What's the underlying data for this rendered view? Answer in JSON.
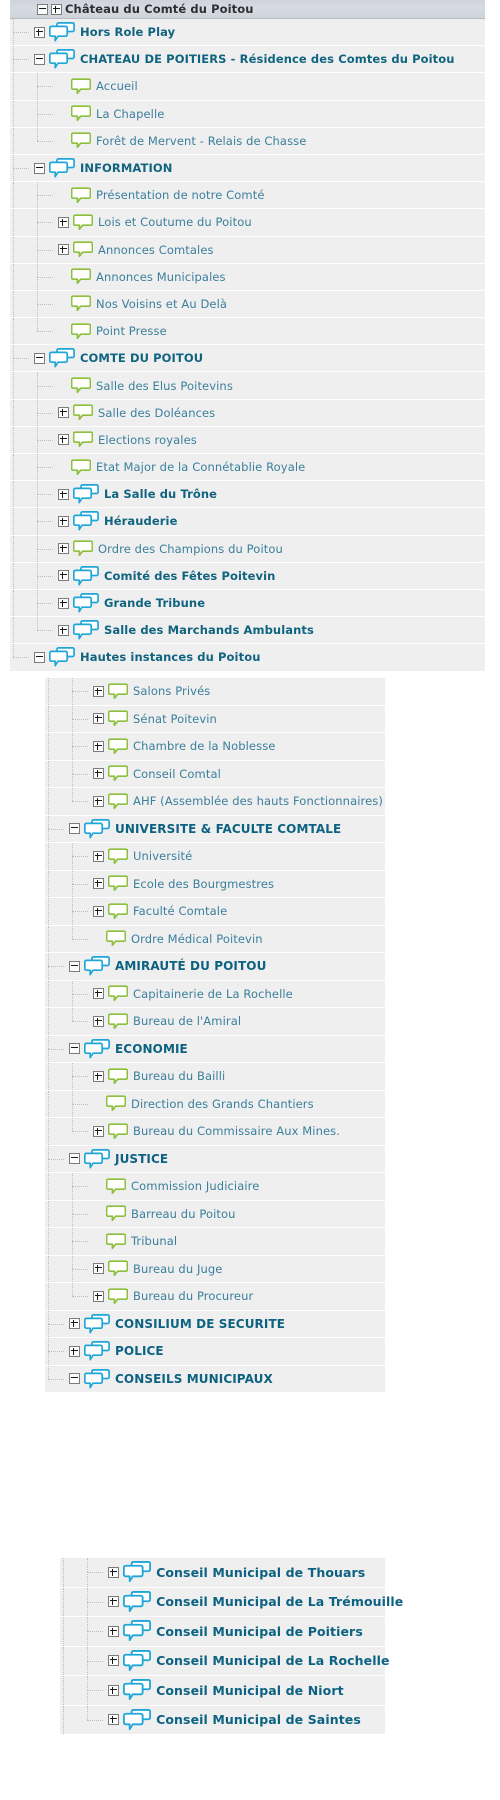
{
  "colors": {
    "row_bg": "#efeff0",
    "header_bg": "#d3d7de",
    "category_text": "#10647f",
    "subforum_text": "#3a7f9b",
    "root_text": "#2f2f33",
    "bubble_blue": "#1fa6d8",
    "bubble_green": "#8dbf3c"
  },
  "root": {
    "label": "Château du Comté du Poitou",
    "toggle_minus": "-",
    "toggle_plus": "+"
  },
  "sections": {
    "top": [
      {
        "label": "Hors Role Play",
        "style": "cat",
        "icon": "double-bubble-blue-icon",
        "toggle": "plus",
        "indent": 1
      },
      {
        "label": "CHATEAU DE POITIERS - Résidence des Comtes du Poitou",
        "style": "cat",
        "icon": "double-bubble-blue-icon",
        "toggle": "minus",
        "indent": 1
      },
      {
        "label": "Accueil",
        "style": "sub",
        "icon": "single-bubble-green-icon",
        "toggle": "none",
        "indent": 2
      },
      {
        "label": "La Chapelle",
        "style": "sub",
        "icon": "single-bubble-green-icon",
        "toggle": "none",
        "indent": 2
      },
      {
        "label": "Forêt de Mervent - Relais de Chasse",
        "style": "sub",
        "icon": "single-bubble-green-icon",
        "toggle": "none",
        "indent": 2
      },
      {
        "label": "INFORMATION",
        "style": "cat",
        "icon": "double-bubble-blue-icon",
        "toggle": "minus",
        "indent": 1
      },
      {
        "label": "Présentation de notre Comté",
        "style": "sub",
        "icon": "single-bubble-green-icon",
        "toggle": "none",
        "indent": 2
      },
      {
        "label": "Lois et Coutume du Poitou",
        "style": "sub",
        "icon": "single-bubble-green-icon",
        "toggle": "plus",
        "indent": 2
      },
      {
        "label": "Annonces Comtales",
        "style": "sub",
        "icon": "single-bubble-green-icon",
        "toggle": "plus",
        "indent": 2
      },
      {
        "label": "Annonces Municipales",
        "style": "sub",
        "icon": "single-bubble-green-icon",
        "toggle": "none",
        "indent": 2
      },
      {
        "label": "Nos Voisins et Au Delà",
        "style": "sub",
        "icon": "single-bubble-green-icon",
        "toggle": "none",
        "indent": 2
      },
      {
        "label": "Point Presse",
        "style": "sub",
        "icon": "single-bubble-green-icon",
        "toggle": "none",
        "indent": 2
      },
      {
        "label": "COMTE DU POITOU",
        "style": "cat",
        "icon": "double-bubble-blue-icon",
        "toggle": "minus",
        "indent": 1
      },
      {
        "label": "Salle des Elus Poitevins",
        "style": "sub",
        "icon": "single-bubble-green-icon",
        "toggle": "none",
        "indent": 2
      },
      {
        "label": "Salle des Doléances",
        "style": "sub",
        "icon": "single-bubble-green-icon",
        "toggle": "plus",
        "indent": 2
      },
      {
        "label": "Elections royales",
        "style": "sub",
        "icon": "single-bubble-green-icon",
        "toggle": "plus",
        "indent": 2
      },
      {
        "label": "Etat Major de la Connétablie Royale",
        "style": "sub",
        "icon": "single-bubble-green-icon",
        "toggle": "none",
        "indent": 2
      },
      {
        "label": "La Salle du Trône",
        "style": "cat",
        "icon": "double-bubble-blue-icon",
        "toggle": "plus",
        "indent": 2
      },
      {
        "label": "Hérauderie",
        "style": "cat",
        "icon": "double-bubble-blue-icon",
        "toggle": "plus",
        "indent": 2
      },
      {
        "label": "Ordre des Champions du Poitou",
        "style": "sub",
        "icon": "single-bubble-green-icon",
        "toggle": "plus",
        "indent": 2
      },
      {
        "label": "Comité des Fêtes Poitevin",
        "style": "cat",
        "icon": "double-bubble-blue-icon",
        "toggle": "plus",
        "indent": 2
      },
      {
        "label": "Grande Tribune",
        "style": "cat",
        "icon": "double-bubble-blue-icon",
        "toggle": "plus",
        "indent": 2
      },
      {
        "label": "Salle des Marchands Ambulants",
        "style": "cat",
        "icon": "double-bubble-blue-icon",
        "toggle": "plus",
        "indent": 2
      },
      {
        "label": "Hautes instances du Poitou",
        "style": "cat",
        "icon": "double-bubble-blue-icon",
        "toggle": "minus",
        "indent": 1
      }
    ],
    "middle": [
      {
        "label": "Salons Privés",
        "style": "sub",
        "icon": "single-bubble-green-icon",
        "toggle": "plus",
        "indent": 2
      },
      {
        "label": "Sénat Poitevin",
        "style": "sub",
        "icon": "single-bubble-green-icon",
        "toggle": "plus",
        "indent": 2
      },
      {
        "label": "Chambre de la Noblesse",
        "style": "sub",
        "icon": "single-bubble-green-icon",
        "toggle": "plus",
        "indent": 2
      },
      {
        "label": "Conseil Comtal",
        "style": "sub",
        "icon": "single-bubble-green-icon",
        "toggle": "plus",
        "indent": 2
      },
      {
        "label": "AHF (Assemblée des hauts Fonctionnaires)",
        "style": "sub",
        "icon": "single-bubble-green-icon",
        "toggle": "plus",
        "indent": 2
      },
      {
        "label": "UNIVERSITE & FACULTE COMTALE",
        "style": "catbig",
        "icon": "double-bubble-blue-icon",
        "toggle": "minus",
        "indent": 1
      },
      {
        "label": "Université",
        "style": "sub",
        "icon": "single-bubble-green-icon",
        "toggle": "plus",
        "indent": 2
      },
      {
        "label": "Ecole des Bourgmestres",
        "style": "sub",
        "icon": "single-bubble-green-icon",
        "toggle": "plus",
        "indent": 2
      },
      {
        "label": "Faculté Comtale",
        "style": "sub",
        "icon": "single-bubble-green-icon",
        "toggle": "plus",
        "indent": 2
      },
      {
        "label": "Ordre Médical Poitevin",
        "style": "sub",
        "icon": "single-bubble-green-icon",
        "toggle": "none",
        "indent": 2
      },
      {
        "label": "AMIRAUTÉ DU POITOU",
        "style": "catbig",
        "icon": "double-bubble-blue-icon",
        "toggle": "minus",
        "indent": 1
      },
      {
        "label": "Capitainerie de La Rochelle",
        "style": "sub",
        "icon": "single-bubble-green-icon",
        "toggle": "plus",
        "indent": 2
      },
      {
        "label": "Bureau de l'Amiral",
        "style": "sub",
        "icon": "single-bubble-green-icon",
        "toggle": "plus",
        "indent": 2
      },
      {
        "label": "ECONOMIE",
        "style": "catbig",
        "icon": "double-bubble-blue-icon",
        "toggle": "minus",
        "indent": 1
      },
      {
        "label": "Bureau du Bailli",
        "style": "sub",
        "icon": "single-bubble-green-icon",
        "toggle": "plus",
        "indent": 2
      },
      {
        "label": "Direction des Grands Chantiers",
        "style": "sub",
        "icon": "single-bubble-green-icon",
        "toggle": "none",
        "indent": 2
      },
      {
        "label": "Bureau du Commissaire Aux Mines.",
        "style": "sub",
        "icon": "single-bubble-green-icon",
        "toggle": "plus",
        "indent": 2
      },
      {
        "label": "JUSTICE",
        "style": "catbig",
        "icon": "double-bubble-blue-icon",
        "toggle": "minus",
        "indent": 1
      },
      {
        "label": "Commission Judiciaire",
        "style": "sub",
        "icon": "single-bubble-green-icon",
        "toggle": "none",
        "indent": 2
      },
      {
        "label": "Barreau du Poitou",
        "style": "sub",
        "icon": "single-bubble-green-icon",
        "toggle": "none",
        "indent": 2
      },
      {
        "label": "Tribunal",
        "style": "sub",
        "icon": "single-bubble-green-icon",
        "toggle": "none",
        "indent": 2
      },
      {
        "label": "Bureau du Juge",
        "style": "sub",
        "icon": "single-bubble-green-icon",
        "toggle": "plus",
        "indent": 2
      },
      {
        "label": "Bureau du Procureur",
        "style": "sub",
        "icon": "single-bubble-green-icon",
        "toggle": "plus",
        "indent": 2
      },
      {
        "label": "CONSILIUM DE SECURITE",
        "style": "catbig",
        "icon": "double-bubble-blue-icon",
        "toggle": "plus",
        "indent": 1
      },
      {
        "label": "POLICE",
        "style": "catbig",
        "icon": "double-bubble-blue-icon",
        "toggle": "plus",
        "indent": 1
      },
      {
        "label": "CONSEILS MUNICIPAUX",
        "style": "catbig",
        "icon": "double-bubble-blue-icon",
        "toggle": "minus",
        "indent": 1
      }
    ],
    "bottom": [
      {
        "label": "Conseil Municipal de Thouars",
        "style": "muni",
        "icon": "double-bubble-blue-icon",
        "toggle": "plus",
        "indent": 2
      },
      {
        "label": "Conseil Municipal de La Trémouille",
        "style": "muni",
        "icon": "double-bubble-blue-icon",
        "toggle": "plus",
        "indent": 2
      },
      {
        "label": "Conseil Municipal de Poitiers",
        "style": "muni",
        "icon": "double-bubble-blue-icon",
        "toggle": "plus",
        "indent": 2
      },
      {
        "label": "Conseil Municipal de La Rochelle",
        "style": "muni",
        "icon": "double-bubble-blue-icon",
        "toggle": "plus",
        "indent": 2
      },
      {
        "label": "Conseil Municipal de Niort",
        "style": "muni",
        "icon": "double-bubble-blue-icon",
        "toggle": "plus",
        "indent": 2
      },
      {
        "label": "Conseil Municipal de Saintes",
        "style": "muni",
        "icon": "double-bubble-blue-icon",
        "toggle": "plus",
        "indent": 2
      }
    ]
  }
}
